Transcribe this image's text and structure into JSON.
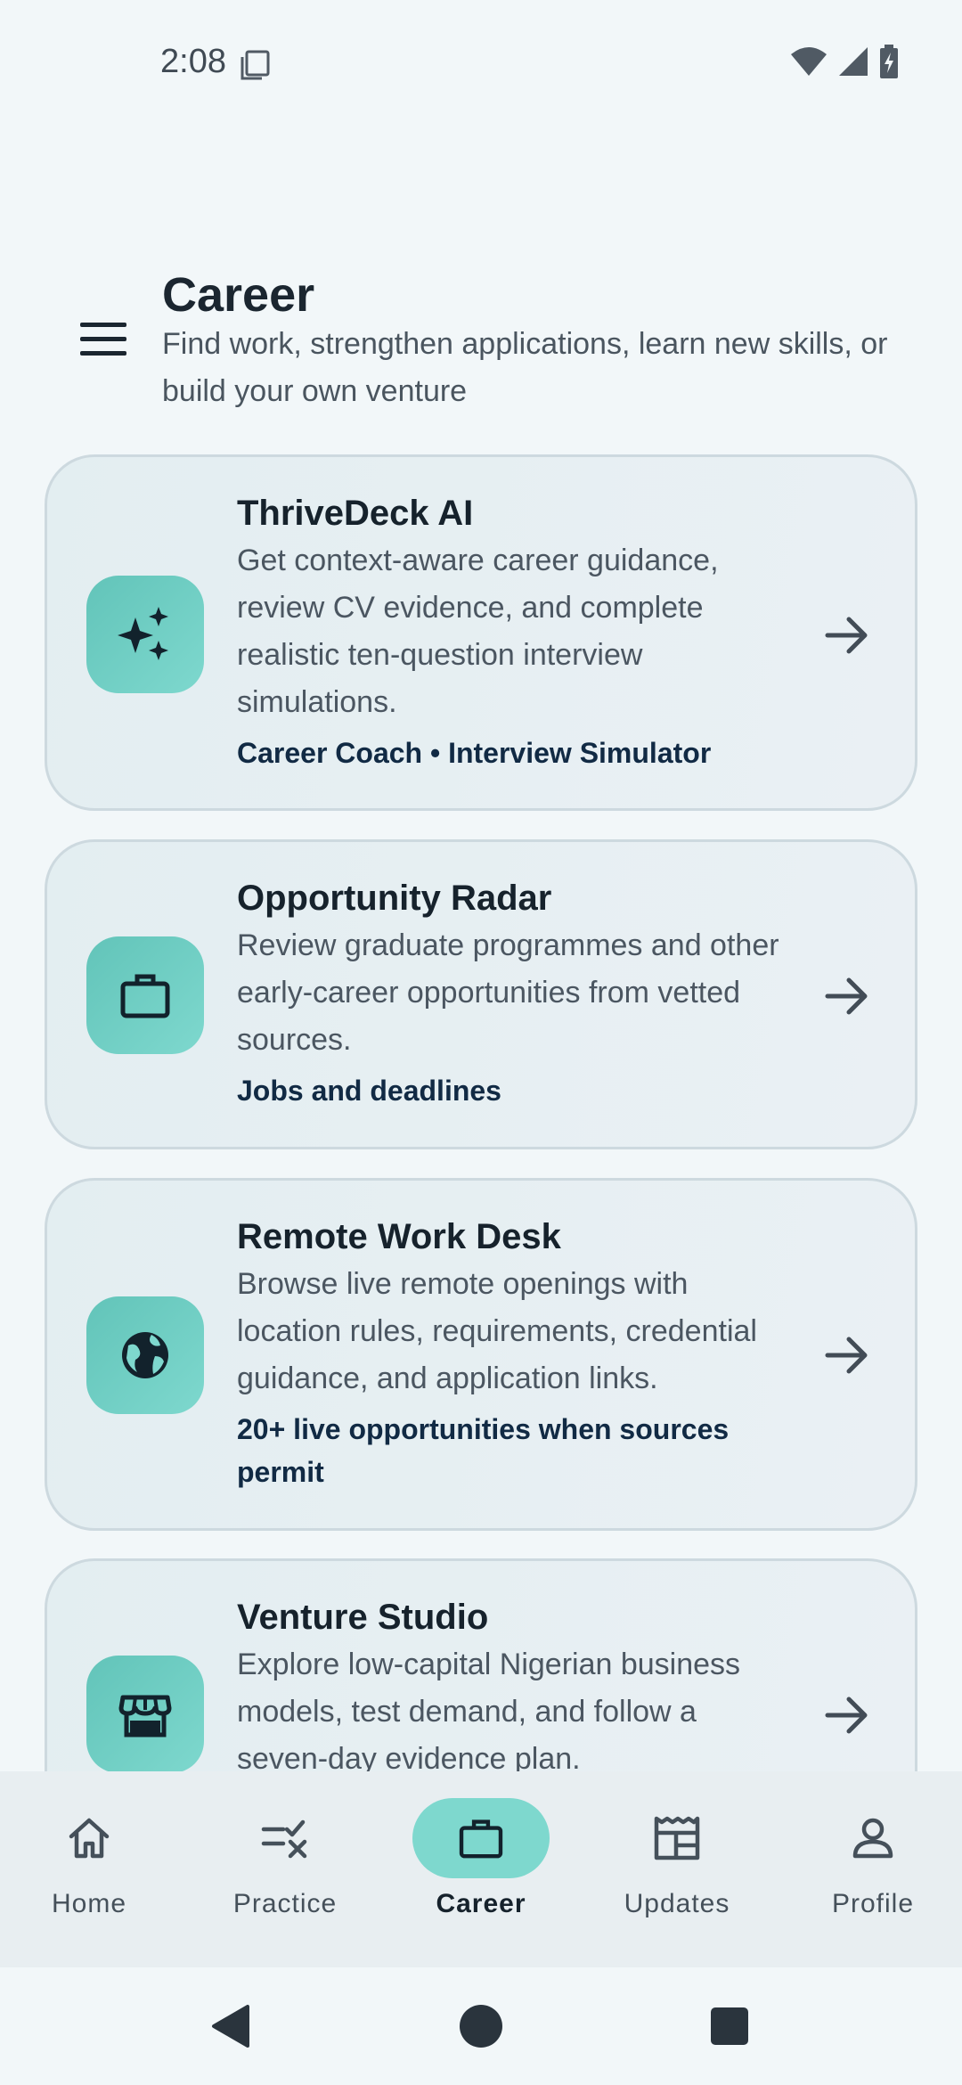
{
  "status_bar": {
    "time": "2:08"
  },
  "header": {
    "title": "Career",
    "subtitle": "Find work, strengthen applications, learn new skills, or build your own venture"
  },
  "cards": [
    {
      "title": "ThriveDeck AI",
      "description": "Get context-aware career guidance, review CV evidence, and complete realistic ten-question interview simulations.",
      "tag": "Career Coach • Interview Simulator",
      "icon": "sparkle-icon"
    },
    {
      "title": "Opportunity Radar",
      "description": "Review graduate programmes and other early-career opportunities from vetted sources.",
      "tag": "Jobs and deadlines",
      "icon": "briefcase-icon"
    },
    {
      "title": "Remote Work Desk",
      "description": "Browse live remote openings with location rules, requirements, credential guidance, and application links.",
      "tag": "20+ live opportunities when sources permit",
      "icon": "globe-icon"
    },
    {
      "title": "Venture Studio",
      "description": "Explore low-capital Nigerian business models, test demand, and follow a seven-day evidence plan.",
      "tag": "",
      "icon": "storefront-icon"
    }
  ],
  "bottom_nav": {
    "items": [
      {
        "label": "Home",
        "icon": "home-icon"
      },
      {
        "label": "Practice",
        "icon": "practice-icon"
      },
      {
        "label": "Career",
        "icon": "briefcase-icon",
        "active": true
      },
      {
        "label": "Updates",
        "icon": "newspaper-icon"
      },
      {
        "label": "Profile",
        "icon": "person-icon"
      }
    ]
  },
  "colors": {
    "accent": "#7ed8ce",
    "background": "#f2f7f9",
    "card_border": "#cdd9df",
    "text_primary": "#16222c"
  }
}
